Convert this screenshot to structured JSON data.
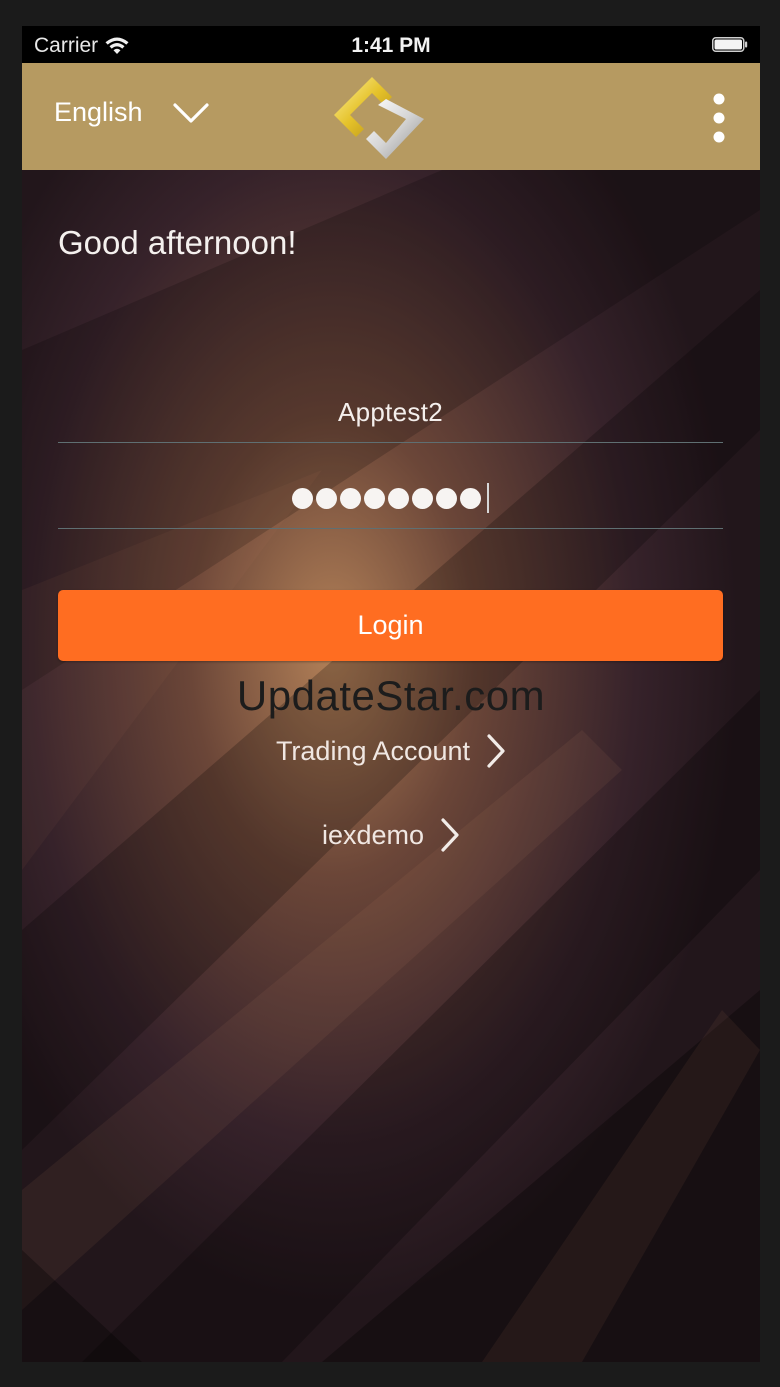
{
  "status_bar": {
    "carrier": "Carrier",
    "time": "1:41 PM"
  },
  "header": {
    "language": "English",
    "logo_icon": "gold-diamond-logo-icon",
    "menu_icon": "vertical-dots-icon"
  },
  "login": {
    "greeting": "Good afternoon!",
    "username": "Apptest2",
    "password_length": 8,
    "login_label": "Login"
  },
  "watermark": "UpdateStar.com",
  "links": {
    "trading_account": "Trading Account",
    "server": "iexdemo"
  },
  "colors": {
    "header": "#b69a61",
    "login_button": "#ff6d21",
    "background_dark": "#2a1a1e",
    "background_glow": "#b07c56"
  }
}
